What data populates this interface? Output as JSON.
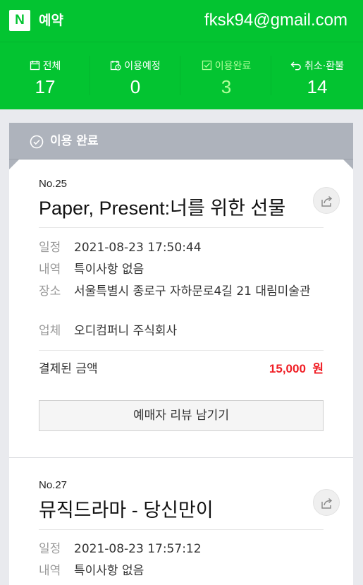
{
  "header": {
    "logo_letter": "N",
    "title": "예약",
    "email": "fksk94@gmail.com",
    "brand_color": "#03c431"
  },
  "stats": [
    {
      "icon": "calendar-icon",
      "label": "전체",
      "value": "17"
    },
    {
      "icon": "calendar-clock-icon",
      "label": "이용예정",
      "value": "0"
    },
    {
      "icon": "checkbox-icon",
      "label": "이용완료",
      "value": "3",
      "active": true
    },
    {
      "icon": "undo-arrow-icon",
      "label": "취소·환불",
      "value": "14"
    }
  ],
  "section": {
    "icon": "check-circle-icon",
    "title": "이용 완료"
  },
  "cards": [
    {
      "no": "No.25",
      "title": "Paper, Present:너를 위한 선물",
      "rows": [
        {
          "k": "일정",
          "v": "2021-08-23 17:50:44"
        },
        {
          "k": "내역",
          "v": "특이사항 없음"
        },
        {
          "k": "장소",
          "v": "서울특별시 종로구 자하문로4길 21 대림미술관"
        },
        {
          "k": "업체",
          "v": "오디컴퍼니 주식회사"
        }
      ],
      "paid_label": "결제된 금액",
      "paid_amount": "15,000",
      "paid_unit": "원",
      "review_button": "예매자 리뷰 남기기"
    },
    {
      "no": "No.27",
      "title": "뮤직드라마 - 당신만이",
      "rows": [
        {
          "k": "일정",
          "v": "2021-08-23 17:57:12"
        },
        {
          "k": "내역",
          "v": "특이사항 없음"
        }
      ]
    }
  ],
  "accent_red": "#f01e25"
}
